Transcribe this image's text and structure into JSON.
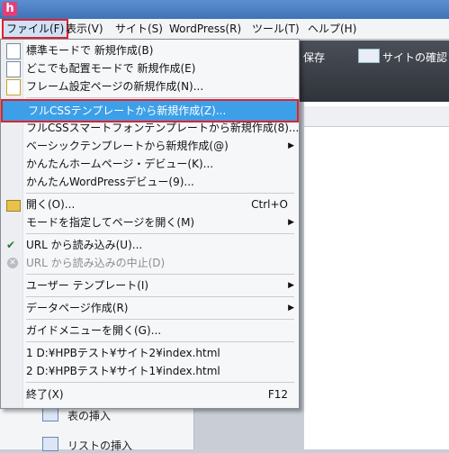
{
  "menubar": {
    "items": [
      "ファイル(F)",
      "表示(V)",
      "サイト(S)",
      "WordPress(R)",
      "ツール(T)",
      "ヘルプ(H)"
    ]
  },
  "toolbar": {
    "save": "保存",
    "site_check": "サイトの確認"
  },
  "leftpanel": {
    "table_insert": "表の挿入",
    "list_insert": "リストの挿入"
  },
  "file_menu": {
    "new_standard": "標準モードで 新規作成(B)",
    "new_anywhere": "どこでも配置モードで 新規作成(E)",
    "new_frame": "フレーム設定ページの新規作成(N)...",
    "new_fullcss": "フルCSSテンプレートから新規作成(Z)...",
    "new_fullcss_sp": "フルCSSスマートフォンテンプレートから新規作成(8)...",
    "new_basic": "ベーシックテンプレートから新規作成(@)",
    "debut_home": "かんたんホームページ・デビュー(K)...",
    "debut_wp": "かんたんWordPressデビュー(9)...",
    "open": "開く(O)...",
    "open_shortcut": "Ctrl+O",
    "open_mode": "モードを指定してページを開く(M)",
    "url_load": "URL から読み込み(U)...",
    "url_abort": "URL から読み込みの中止(D)",
    "user_template": "ユーザー テンプレート(I)",
    "data_page": "データページ作成(R)",
    "guide_menu": "ガイドメニューを開く(G)...",
    "recent1": "1 D:¥HPBテスト¥サイト2¥index.html",
    "recent2": "2 D:¥HPBテスト¥サイト1¥index.html",
    "exit": "終了(X)",
    "exit_shortcut": "F12"
  }
}
